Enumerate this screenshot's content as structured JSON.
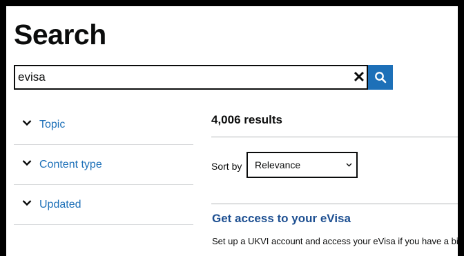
{
  "page": {
    "title": "Search"
  },
  "search": {
    "value": "evisa",
    "clear_icon": "close-icon",
    "button_icon": "search-icon"
  },
  "filters": [
    {
      "label": "Topic",
      "icon": "chevron-down-icon"
    },
    {
      "label": "Content type",
      "icon": "chevron-down-icon"
    },
    {
      "label": "Updated",
      "icon": "chevron-down-icon"
    }
  ],
  "results": {
    "count_text": "4,006 results",
    "sort_label": "Sort by",
    "sort_value": "Relevance",
    "items": [
      {
        "title": "Get access to your eVisa",
        "description": "Set up a UKVI account and access your eVisa if you have a bion"
      }
    ]
  },
  "colors": {
    "link": "#1d70b8",
    "result_title": "#1d4f91",
    "search_button": "#1d70b8",
    "text": "#0b0c0c"
  }
}
